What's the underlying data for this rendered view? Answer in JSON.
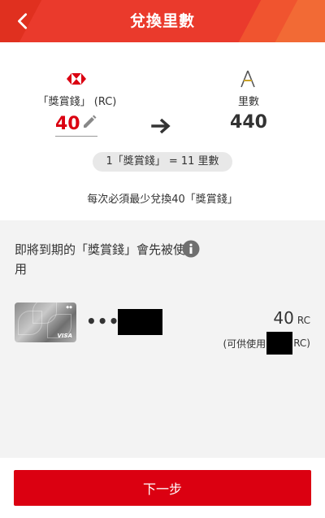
{
  "header": {
    "title": "兌換里數",
    "back_icon": "chevron-left-icon"
  },
  "exchange": {
    "from_label": "「獎賞錢」 (RC)",
    "from_amount": "40",
    "to_label": "里數",
    "to_amount": "440",
    "rate": "1「獎賞錢」 = 11 里數",
    "minimum_note": "每次必須最少兌換40「獎賞錢」"
  },
  "card_section": {
    "expire_text": "即將到期的「獎賞錢」會先被使用",
    "card_dots": "••••",
    "card_brand": "VISA",
    "rc_value": "40",
    "rc_unit": "RC",
    "available_prefix": "(可供使用",
    "available_suffix": "RC)"
  },
  "footer": {
    "next_label": "下一步"
  },
  "colors": {
    "brand_red": "#db0011",
    "header_red": "#ea3a2c",
    "section_gray": "#f3f3f3"
  }
}
